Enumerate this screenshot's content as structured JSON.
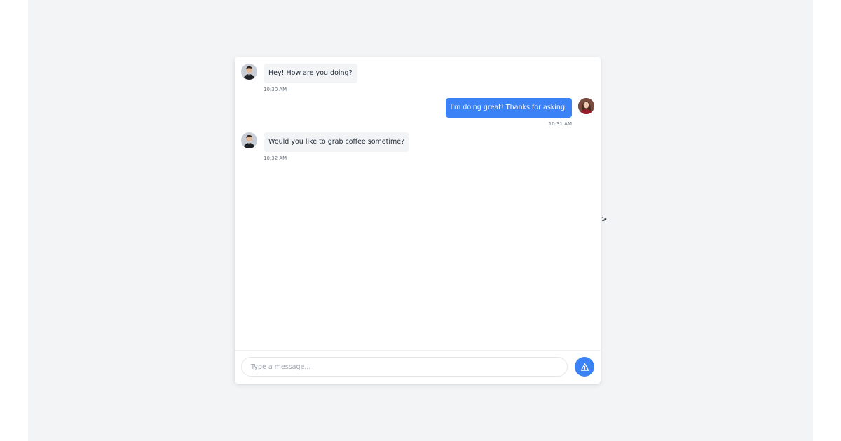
{
  "colors": {
    "page_background": "#f3f4f6",
    "outgoing_bubble": "#3b82f6",
    "incoming_bubble": "#f3f4f6",
    "send_button": "#3b82f6"
  },
  "messages": [
    {
      "direction": "incoming",
      "avatar": "male-avatar",
      "text": "Hey! How are you doing?",
      "time": "10:30 AM"
    },
    {
      "direction": "outgoing",
      "avatar": "female-avatar",
      "text": "I'm doing great! Thanks for asking.",
      "time": "10:31 AM"
    },
    {
      "direction": "incoming",
      "avatar": "male-avatar",
      "text": "Would you like to grab coffee sometime?",
      "time": "10:32 AM"
    }
  ],
  "composer": {
    "placeholder": "Type a message...",
    "value": "",
    "send_icon": "send-icon"
  },
  "stray_text": ">"
}
